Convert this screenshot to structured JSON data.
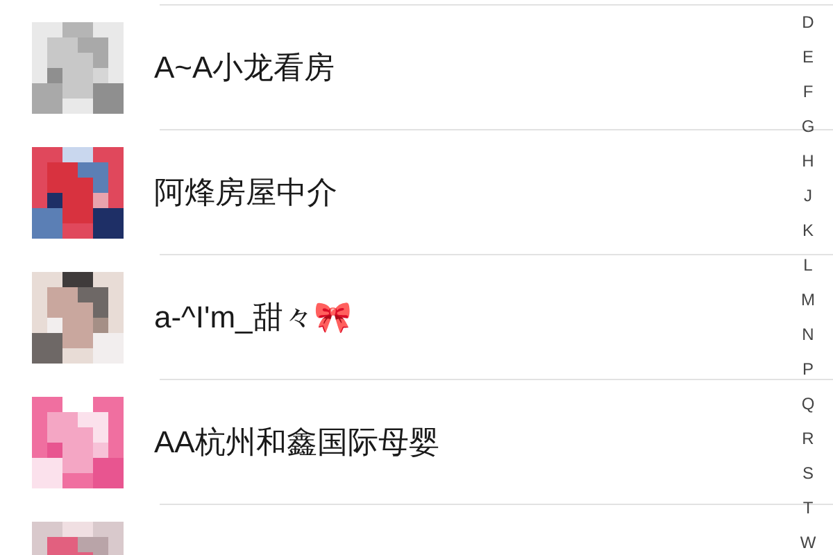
{
  "contacts": [
    {
      "name": "A~A小龙看房",
      "avatar": {
        "kind": "picture"
      }
    },
    {
      "name": "阿烽房屋中介",
      "avatar": {
        "kind": "picture"
      }
    },
    {
      "name": "a-^I'm_甜々🎀",
      "avatar": {
        "kind": "picture"
      }
    },
    {
      "name": "AA杭州和鑫国际母婴",
      "avatar": {
        "kind": "picture"
      }
    },
    {
      "avatar": {
        "kind": "picture"
      }
    }
  ],
  "index_letters": [
    "D",
    "E",
    "F",
    "G",
    "H",
    "J",
    "K",
    "L",
    "M",
    "N",
    "P",
    "Q",
    "R",
    "S",
    "T",
    "W"
  ]
}
